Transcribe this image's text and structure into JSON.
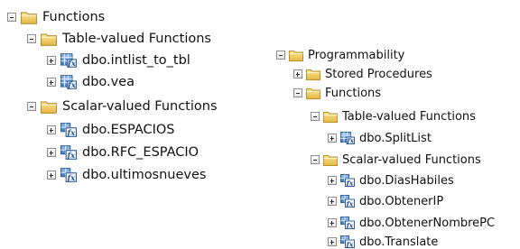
{
  "left_tree": {
    "root": "Functions",
    "table_valued": {
      "label": "Table-valued Functions",
      "items": [
        "dbo.intlist_to_tbl",
        "dbo.vea"
      ]
    },
    "scalar_valued": {
      "label": "Scalar-valued Functions",
      "items": [
        "dbo.ESPACIOS",
        "dbo.RFC_ESPACIO",
        "dbo.ultimosnueves"
      ]
    }
  },
  "right_tree": {
    "root": "Programmability",
    "stored_procedures": "Stored Procedures",
    "functions": "Functions",
    "table_valued": {
      "label": "Table-valued Functions",
      "items": [
        "dbo.SplitList"
      ]
    },
    "scalar_valued": {
      "label": "Scalar-valued Functions",
      "items": [
        "dbo.DiasHabiles",
        "dbo.ObtenerIP",
        "dbo.ObtenerNombrePC",
        "dbo.Translate"
      ]
    }
  },
  "icons": {
    "folder": "folder-icon",
    "table_function": "table-valued-function-icon",
    "scalar_function": "scalar-valued-function-icon",
    "expand": "expand-icon",
    "collapse": "collapse-icon"
  },
  "colors": {
    "folder_yellow": "#f2c94c",
    "function_blue": "#3d78c9",
    "expander_border": "#8c8c8c"
  }
}
